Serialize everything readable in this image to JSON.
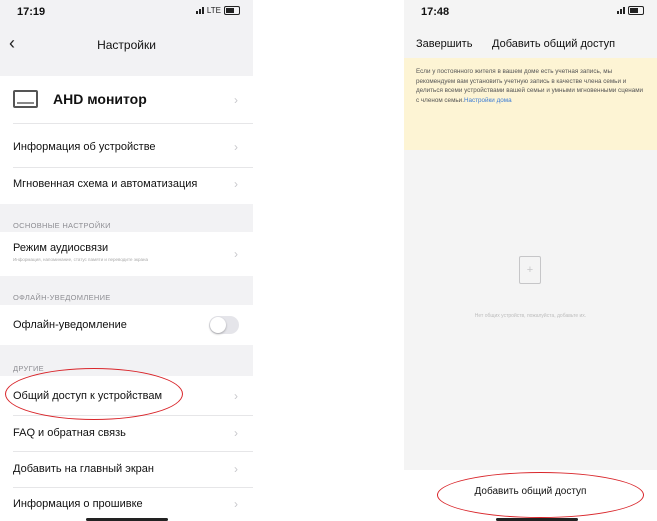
{
  "left": {
    "status": {
      "time": "17:19",
      "network": "LTE"
    },
    "nav": {
      "title": "Настройки"
    },
    "device": {
      "name": "AHD монитор"
    },
    "rows": {
      "device_info": "Информация об устройстве",
      "scenes": "Мгновенная схема и автоматизация",
      "audio_mode": "Режим аудиосвязи",
      "audio_mode_sub": "Информация, напоминание, статус памяти и переводите экрана",
      "offline_notice": "Офлайн-уведомление",
      "share": "Общий доступ к устройствам",
      "faq": "FAQ и обратная связь",
      "home_screen": "Добавить на главный экран",
      "firmware": "Информация о прошивке"
    },
    "sections": {
      "basic": "ОСНОВНЫЕ НАСТРОЙКИ",
      "offline": "ОФЛАЙН-УВЕДОМЛЕНИЕ",
      "other": "ДРУГИЕ"
    },
    "toggles": {
      "offline_notice": false
    }
  },
  "right": {
    "status": {
      "time": "17:48"
    },
    "nav": {
      "done": "Завершить",
      "title": "Добавить общий доступ"
    },
    "notice": {
      "text": "Если у постоянного жителя в вашем доме есть учетная запись, мы рекомендуем вам установить учетную запись в качестве члена семьи и делиться всеми устройствами вашей семьи и умными мгновенными сценами с членом семьи.",
      "link": "Настройки дома"
    },
    "empty": "Нет общих устройств, пожалуйста, добавьте их.",
    "add_button": "Добавить общий доступ"
  },
  "colors": {
    "highlight": "#d9262b",
    "link": "#3a7bd5",
    "notice_bg": "#fdf4d4"
  },
  "icons": [
    "chevron-left-icon",
    "monitor-icon",
    "chevron-right-icon",
    "document-add-icon",
    "battery-icon",
    "signal-icon"
  ]
}
